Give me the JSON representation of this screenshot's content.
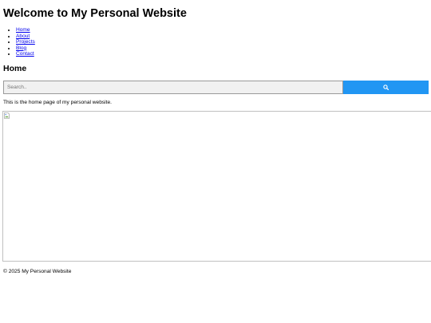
{
  "header": {
    "title": "Welcome to My Personal Website"
  },
  "nav": {
    "items": [
      {
        "label": "Home"
      },
      {
        "label": "About"
      },
      {
        "label": "Projects"
      },
      {
        "label": "Blog"
      },
      {
        "label": "Contact"
      }
    ]
  },
  "main": {
    "section_title": "Home",
    "search": {
      "placeholder": "Search..",
      "value": "",
      "button_icon": "search-icon"
    },
    "intro": "This is the home page of my personal website.",
    "image": {
      "icon": "broken-image-icon"
    }
  },
  "footer": {
    "text": "© 2025 My Personal Website"
  },
  "colors": {
    "search_button": "#2196f3",
    "link": "#0000ee"
  }
}
